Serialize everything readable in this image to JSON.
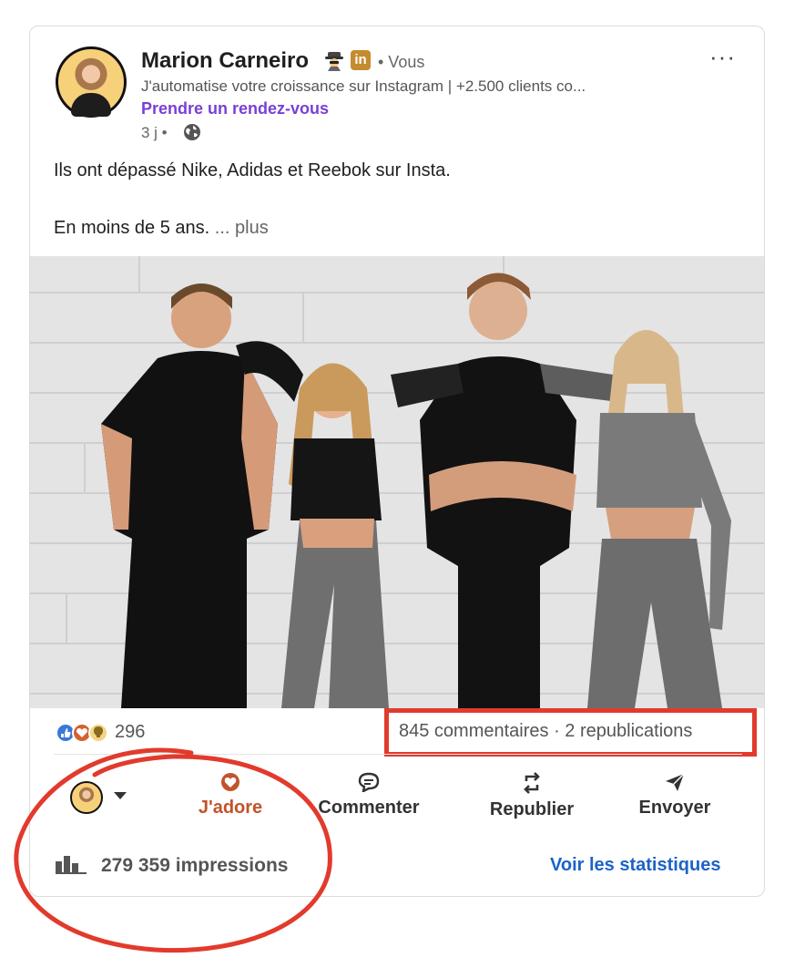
{
  "post": {
    "author_name": "Marion Carneiro",
    "author_badge": "in",
    "connection": "• Vous",
    "headline": "J'automatise votre croissance sur Instagram | +2.500 clients co...",
    "cta": "Prendre un rendez-vous",
    "time": "3 j •",
    "more_options": "···",
    "text_line1": "Ils ont dépassé Nike, Adidas et Reebok sur Insta.",
    "text_line2": "En moins de 5 ans.",
    "see_more": "... plus"
  },
  "engagement": {
    "reactions_count": "296",
    "comments_reposts": "845 commentaires · 2 republications"
  },
  "actions": {
    "love": "J'adore",
    "comment": "Commenter",
    "repost": "Republier",
    "send": "Envoyer"
  },
  "footer": {
    "impressions": "279 359 impressions",
    "stats_link": "Voir les statistiques"
  },
  "colors": {
    "highlight": "#e23a2c",
    "cta": "#7a3fd6",
    "love": "#c2542a",
    "link": "#1d63c7"
  },
  "icons": [
    "spy-icon",
    "globe-icon",
    "love-reaction-icon",
    "comment-icon",
    "repost-icon",
    "send-icon",
    "bar-chart-icon",
    "caret-down-icon"
  ]
}
